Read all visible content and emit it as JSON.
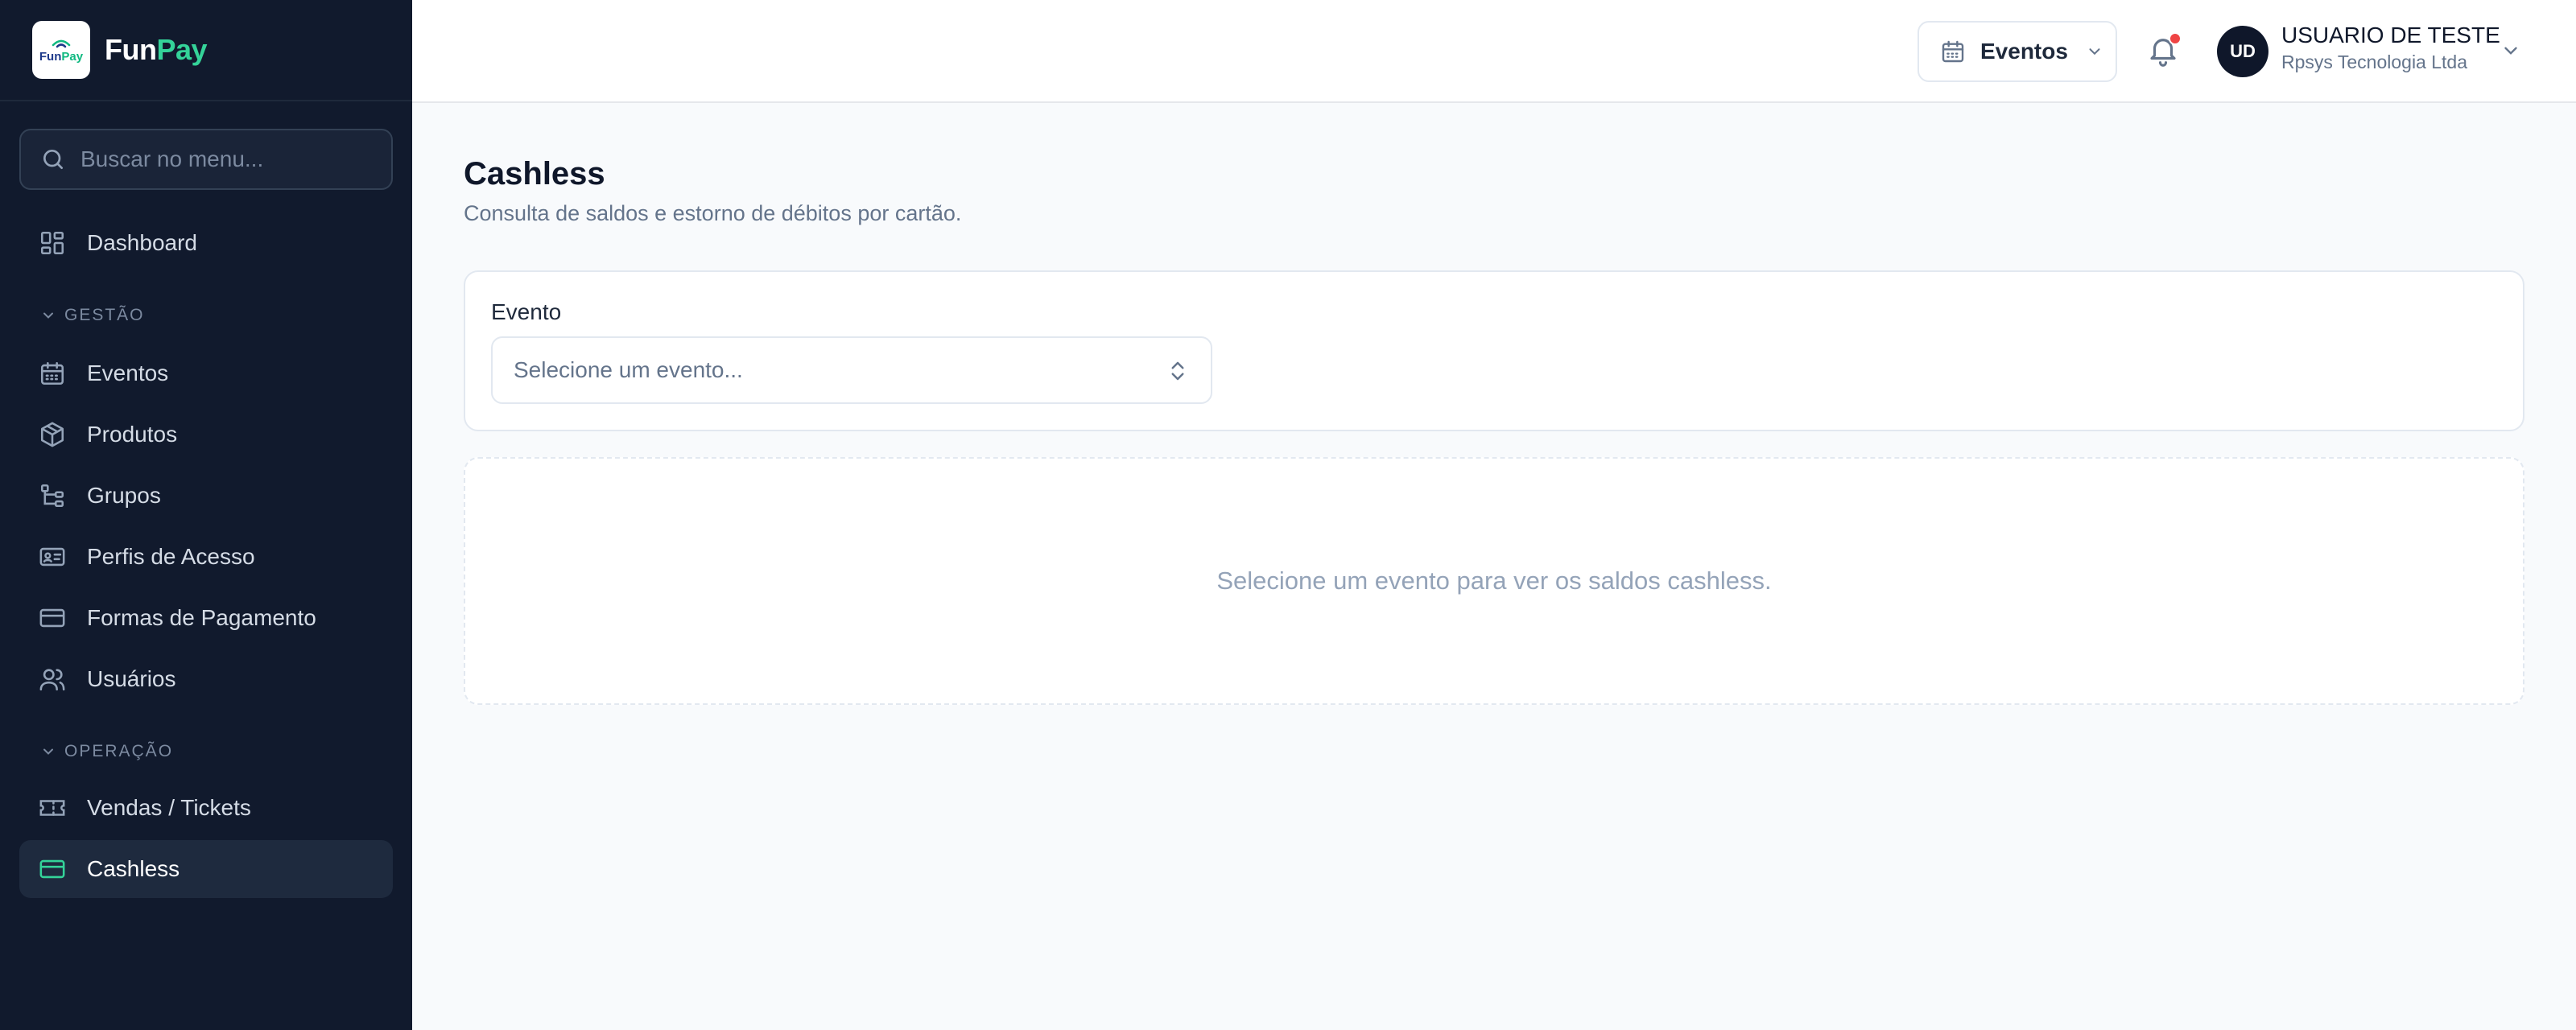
{
  "brand": {
    "logo_fun": "Fun",
    "logo_pay": "Pay",
    "name_fun": "Fun",
    "name_pay": "Pay"
  },
  "search": {
    "placeholder": "Buscar no menu..."
  },
  "sidebar": {
    "dashboard": "Dashboard",
    "section_gestao": "GESTÃO",
    "gestao_items": [
      "Eventos",
      "Produtos",
      "Grupos",
      "Perfis de Acesso",
      "Formas de Pagamento",
      "Usuários"
    ],
    "section_operacao": "OPERAÇÃO",
    "operacao_items": [
      "Vendas / Tickets",
      "Cashless"
    ],
    "active_item": "Cashless"
  },
  "header": {
    "event_button": "Eventos",
    "avatar_initials": "UD",
    "user_name": "USUARIO DE TESTE",
    "user_company": "Rpsys Tecnologia Ltda",
    "notification_dot": true
  },
  "main": {
    "title": "Cashless",
    "subtitle": "Consulta de saldos e estorno de débitos por cartão.",
    "field_label": "Evento",
    "select_placeholder": "Selecione um evento...",
    "empty_message": "Selecione um evento para ver os saldos cashless."
  },
  "colors": {
    "sidebar_bg": "#111a2d",
    "accent": "#34d399",
    "notification": "#ef4444"
  }
}
